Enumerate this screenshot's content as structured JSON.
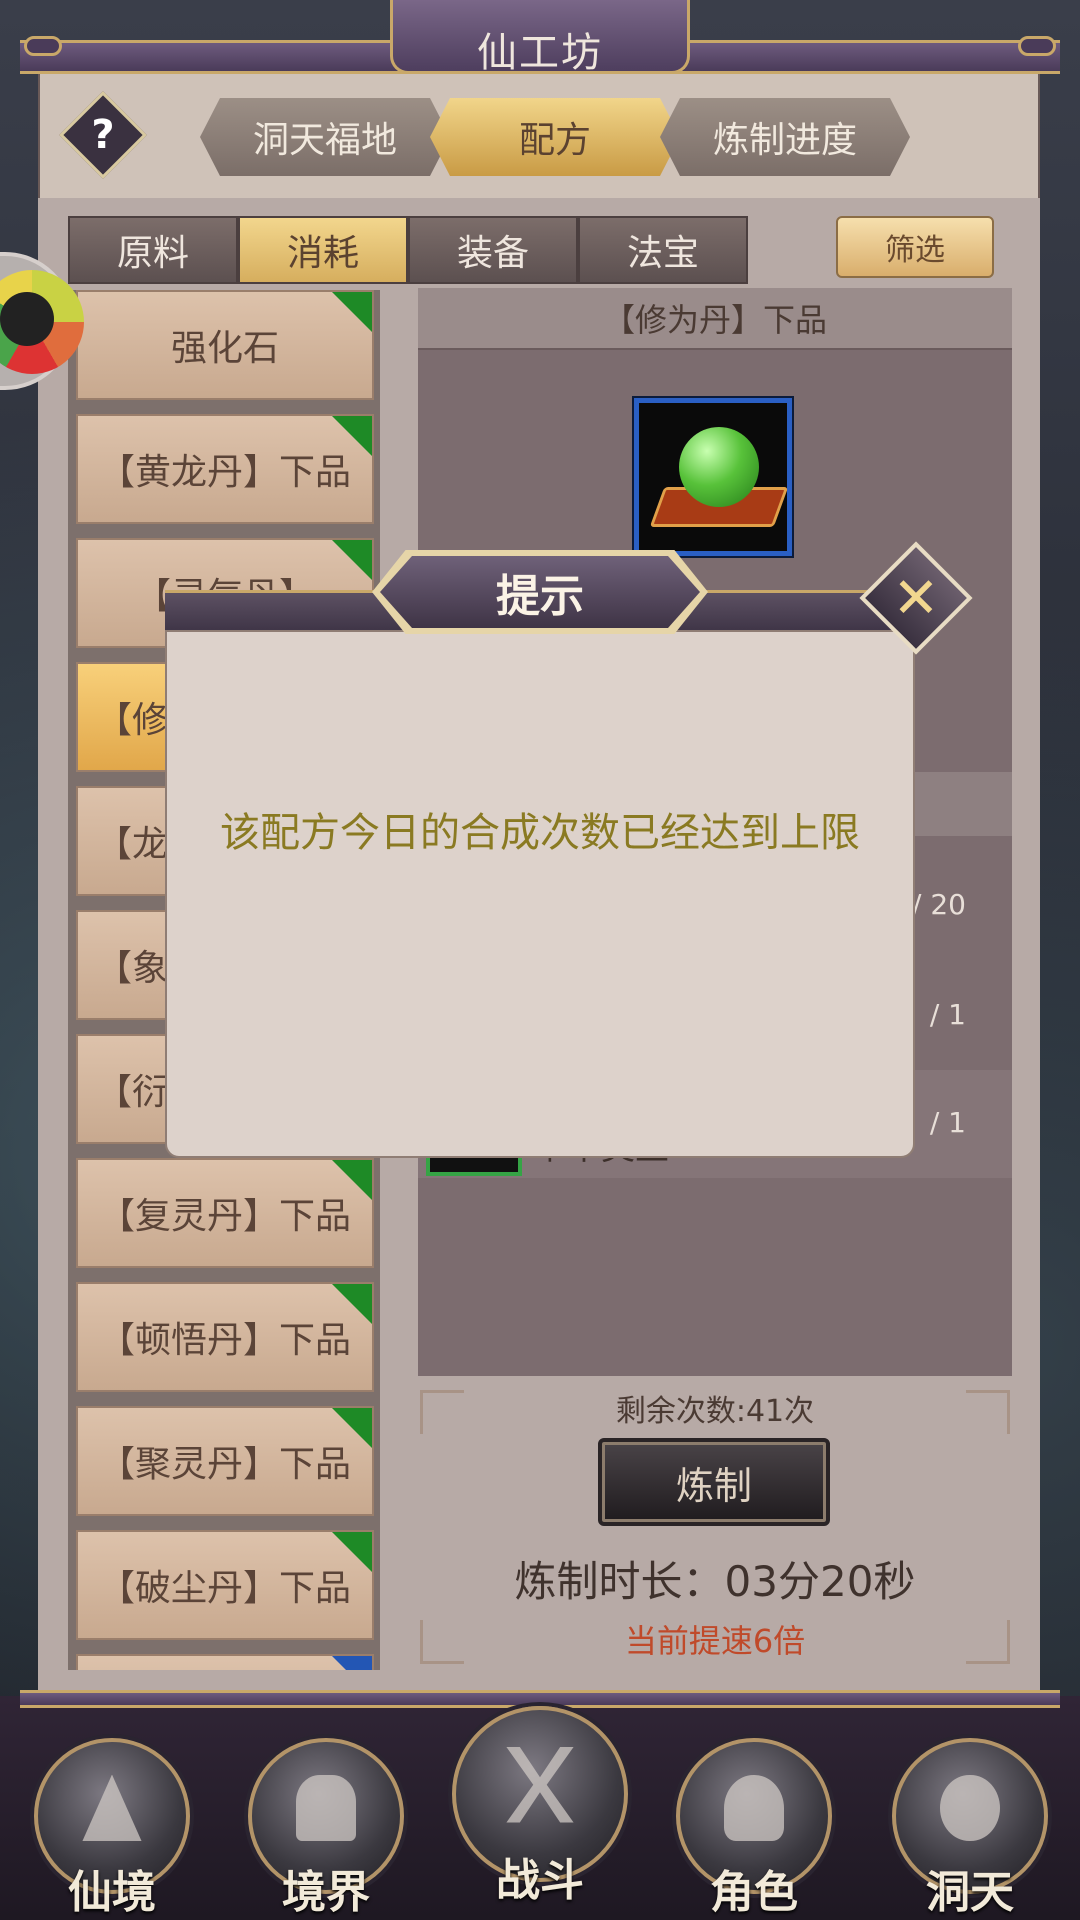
{
  "header": {
    "title": "仙工坊",
    "help": "?"
  },
  "top_tabs": [
    {
      "label": "洞天福地",
      "active": false
    },
    {
      "label": "配方",
      "active": true
    },
    {
      "label": "炼制进度",
      "active": false
    }
  ],
  "sub_tabs": [
    {
      "label": "原料",
      "active": false
    },
    {
      "label": "消耗",
      "active": true
    },
    {
      "label": "装备",
      "active": false
    },
    {
      "label": "法宝",
      "active": false
    }
  ],
  "filter_label": "筛选",
  "recipe_list": [
    {
      "label": "强化石",
      "flag": "green"
    },
    {
      "label": "【黄龙丹】下品",
      "flag": "green"
    },
    {
      "label": "【灵气丹】",
      "flag": "green"
    },
    {
      "label": "【修",
      "flag": "green",
      "selected": true
    },
    {
      "label": "【龙",
      "flag": "green"
    },
    {
      "label": "【象",
      "flag": "green"
    },
    {
      "label": "【衍",
      "flag": "green"
    },
    {
      "label": "【复灵丹】下品",
      "flag": "green"
    },
    {
      "label": "【顿悟丹】下品",
      "flag": "green"
    },
    {
      "label": "【聚灵丹】下品",
      "flag": "green"
    },
    {
      "label": "【破尘丹】下品",
      "flag": "green"
    },
    {
      "label": "",
      "flag": "blue"
    }
  ],
  "detail": {
    "title": "【修为丹】下品",
    "requirements": [
      {
        "count": "/ 20"
      },
      {
        "count": "/ 1"
      },
      {
        "count": "/ 1",
        "name": "草木灵玉"
      }
    ],
    "remaining": "剩余次数:41次",
    "craft_button": "炼制",
    "duration": "炼制时长：03分20秒",
    "speedup": "当前提速6倍"
  },
  "modal": {
    "title": "提示",
    "close": "✕",
    "message": "该配方今日的合成次数已经达到上限"
  },
  "bottom_nav": [
    {
      "label": "仙境"
    },
    {
      "label": "境界"
    },
    {
      "label": "战斗"
    },
    {
      "label": "角色"
    },
    {
      "label": "洞天"
    }
  ],
  "colors": {
    "accent_gold": "#f2d68d",
    "modal_text": "#8a7a22",
    "speed_text": "#c04a2a",
    "flag_green": "#1e8a26"
  }
}
